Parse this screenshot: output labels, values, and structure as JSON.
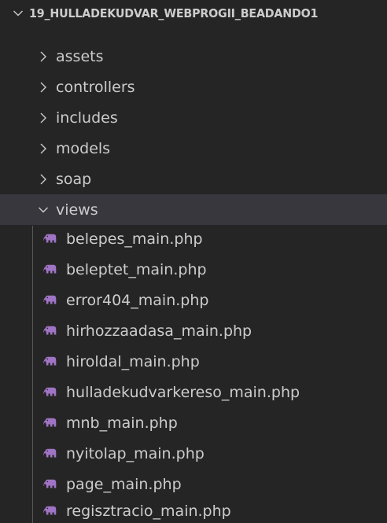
{
  "explorer": {
    "root": {
      "label": "19_HULLADEKUDVAR_WEBPROGII_BEADANDO1",
      "expanded": true
    },
    "folders": [
      {
        "label": "assets",
        "expanded": false
      },
      {
        "label": "controllers",
        "expanded": false
      },
      {
        "label": "includes",
        "expanded": false
      },
      {
        "label": "models",
        "expanded": false
      },
      {
        "label": "soap",
        "expanded": false
      },
      {
        "label": "views",
        "expanded": true
      }
    ],
    "files": [
      {
        "label": "belepes_main.php",
        "icon": "php-elephant-icon"
      },
      {
        "label": "beleptet_main.php",
        "icon": "php-elephant-icon"
      },
      {
        "label": "error404_main.php",
        "icon": "php-elephant-icon"
      },
      {
        "label": "hirhozzaadasa_main.php",
        "icon": "php-elephant-icon"
      },
      {
        "label": "hiroldal_main.php",
        "icon": "php-elephant-icon"
      },
      {
        "label": "hulladekudvarkereso_main.php",
        "icon": "php-elephant-icon"
      },
      {
        "label": "mnb_main.php",
        "icon": "php-elephant-icon"
      },
      {
        "label": "nyitolap_main.php",
        "icon": "php-elephant-icon"
      },
      {
        "label": "page_main.php",
        "icon": "php-elephant-icon"
      },
      {
        "label": "regisztracio_main.php",
        "icon": "php-elephant-icon"
      }
    ],
    "colors": {
      "background": "#252526",
      "text": "#cccccc",
      "selected_row": "#37373d",
      "php_icon": "#a074c4"
    }
  }
}
